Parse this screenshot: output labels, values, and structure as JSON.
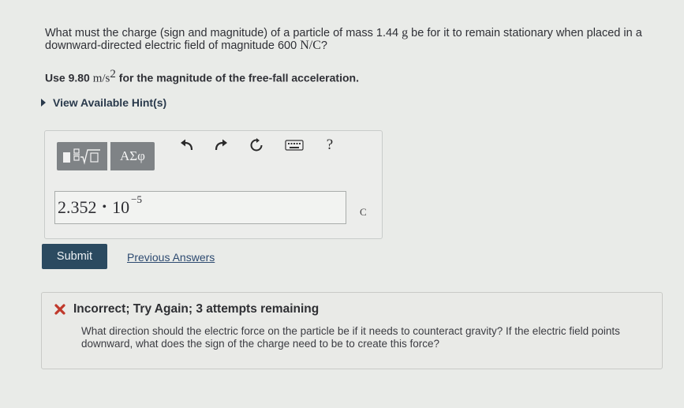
{
  "question": {
    "text_before": "What must the charge (sign and magnitude) of a particle of mass 1.44 ",
    "mass_unit": "g",
    "text_middle": " be for it to remain stationary when placed in a downward-directed electric field of magnitude 600 ",
    "field_unit": "N/C",
    "text_end": "?"
  },
  "use_line": {
    "prefix": "Use 9.80 ",
    "unit": "m/s",
    "exp": "2",
    "suffix": " for the magnitude of the free-fall acceleration."
  },
  "hint": {
    "label": "View Available Hint(s)"
  },
  "toolbar": {
    "templates_icon": "templates-sqrt-icon",
    "symbols_label": "ΑΣφ",
    "undo_icon": "undo-icon",
    "redo_icon": "redo-icon",
    "reset_icon": "reset-icon",
    "keyboard_icon": "keyboard-icon",
    "help_label": "?"
  },
  "answer": {
    "mantissa": "2.352",
    "times": "•",
    "base": "10",
    "exponent": "−5",
    "unit": "C"
  },
  "actions": {
    "submit_label": "Submit",
    "previous_answers_label": "Previous Answers"
  },
  "feedback": {
    "status_icon": "x-icon",
    "title": "Incorrect; Try Again; 3 attempts remaining",
    "body": "What direction should the electric force on the particle be if it needs to counteract gravity? If the electric field points downward, what does the sign of the charge need to be to create this force?"
  },
  "colors": {
    "submit_bg": "#2b4a60",
    "incorrect_red": "#c0392b",
    "toolbar_btn": "#7f8386"
  }
}
